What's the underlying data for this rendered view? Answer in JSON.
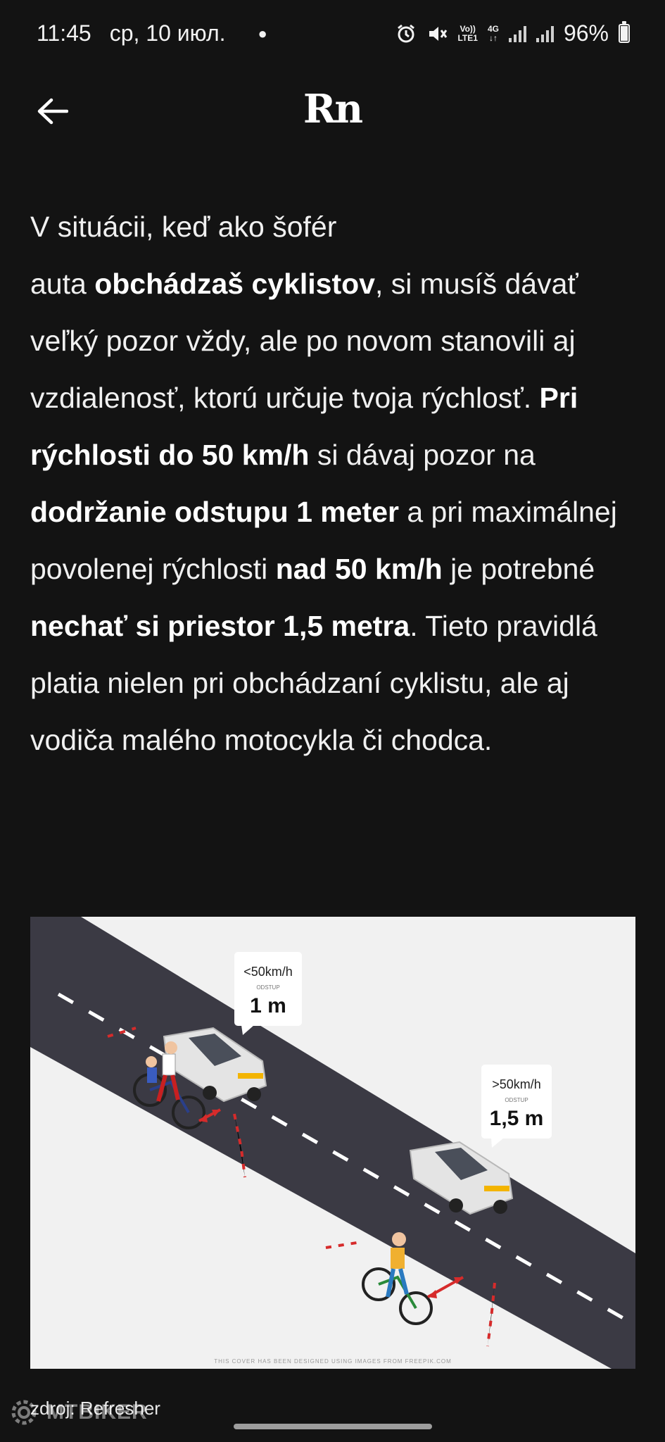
{
  "status_bar": {
    "time": "11:45",
    "date": "ср, 10 июл.",
    "vo_top": "Vo))",
    "vo_bottom": "LTE1",
    "net_top": "4G",
    "net_bottom": "↓↑",
    "battery": "96%",
    "icons": [
      "alarm-icon",
      "mute-icon",
      "volte-icon",
      "4g-icon",
      "signal-icon",
      "signal-icon",
      "battery-icon"
    ]
  },
  "header": {
    "logo": "Rn",
    "back_icon": "arrow-left-icon"
  },
  "article": {
    "segments": [
      {
        "text": "V situácii, keď ako šofér\nauta ",
        "bold": false
      },
      {
        "text": "obchádzaš cyklistov",
        "bold": true
      },
      {
        "text": ", si musíš dávať veľký pozor vždy, ale po novom stanovili aj vzdialenosť, ktorú určuje tvoja rýchlosť. ",
        "bold": false
      },
      {
        "text": "Pri rýchlosti do 50 km/h",
        "bold": true
      },
      {
        "text": " si dávaj pozor na ",
        "bold": false
      },
      {
        "text": "dodržanie odstupu 1 meter",
        "bold": true
      },
      {
        "text": " a pri maximálnej povolenej rýchlosti ",
        "bold": false
      },
      {
        "text": "nad 50 km/h",
        "bold": true
      },
      {
        "text": " je potrebné ",
        "bold": false
      },
      {
        "text": "nechať si priestor 1,5 metra",
        "bold": true
      },
      {
        "text": ". Tieto pravidlá platia nielen pri obchádzaní cyklistu, ale aj vodiča malého motocykla či chodca.",
        "bold": false
      }
    ]
  },
  "figure": {
    "callout_1": {
      "speed": "<50km/h",
      "label": "ODSTUP",
      "distance": "1 m"
    },
    "callout_2": {
      "speed": ">50km/h",
      "label": "ODSTUP",
      "distance": "1,5 m"
    },
    "credit": "THIS COVER HAS BEEN DESIGNED USING IMAGES FROM FREEPIK.COM"
  },
  "caption": "zdroj: Refresher",
  "watermark": "MTBIKER",
  "colors": {
    "background": "#131313",
    "road": "#3b3a44",
    "arrow": "#d62b2b"
  }
}
